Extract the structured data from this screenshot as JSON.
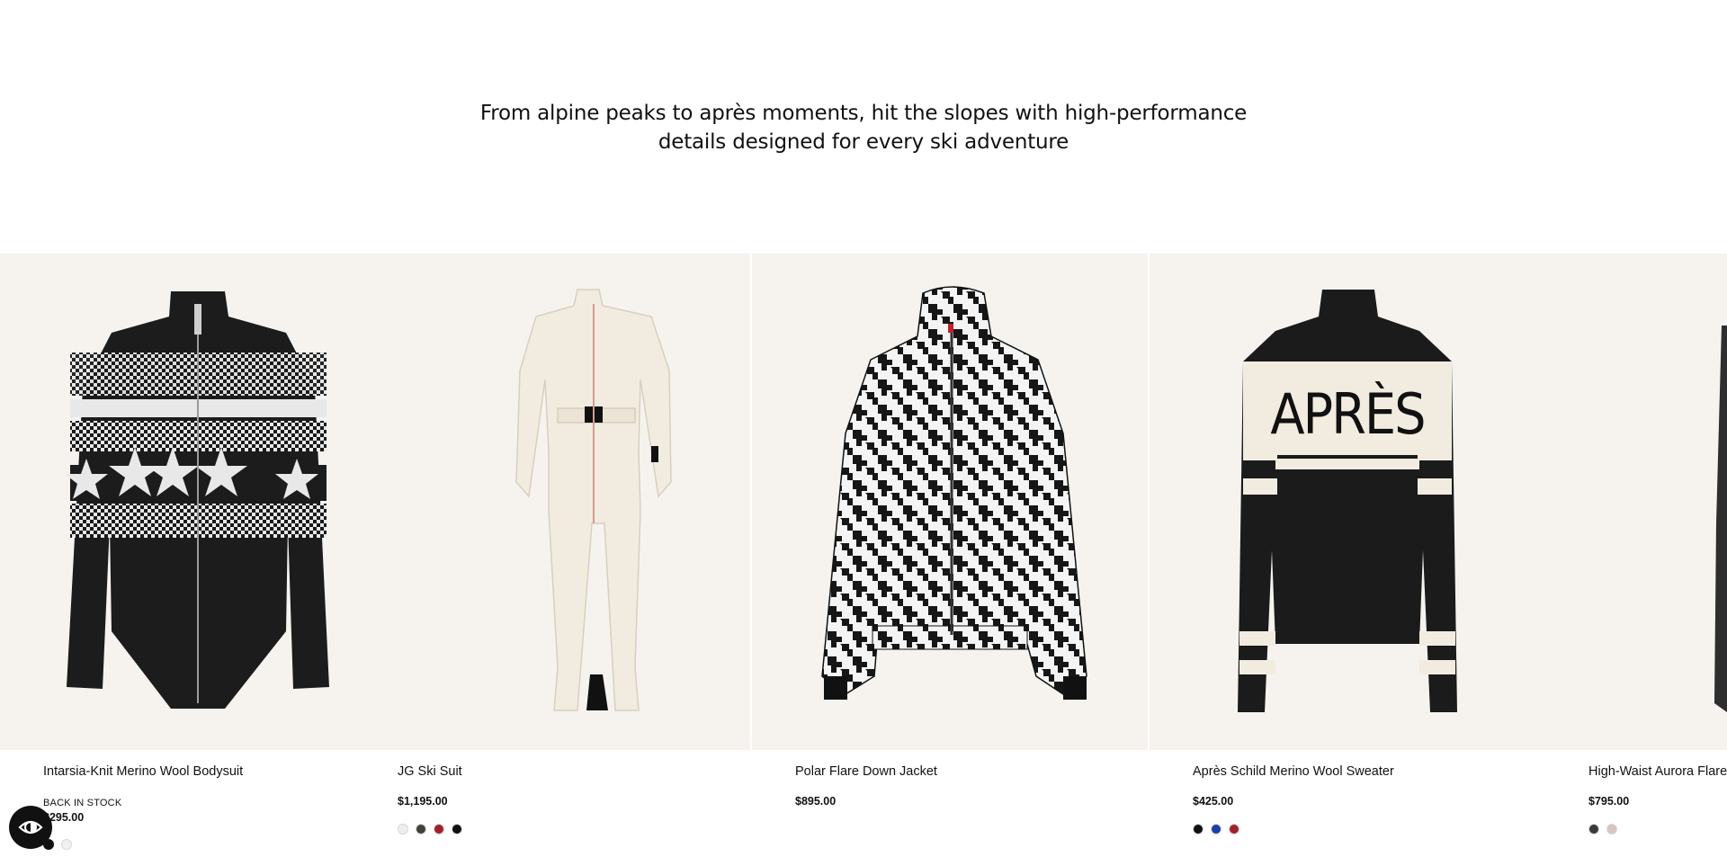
{
  "hero": {
    "line1": "From alpine peaks to après moments, hit the slopes with high-performance",
    "line2": "details designed for every ski adventure"
  },
  "products": [
    {
      "name": "Intarsia-Knit Merino Wool Bodysuit",
      "badge": "BACK IN STOCK",
      "price": "$295.00",
      "image_icon": "bodysuit-image",
      "swatches": [
        "#111111",
        "#f2f2f2"
      ]
    },
    {
      "name": "JG Ski Suit",
      "price": "$1,195.00",
      "image_icon": "ski-suit-image",
      "swatches": [
        "#eeeeee",
        "#3d4436",
        "#a3202a",
        "#111111"
      ]
    },
    {
      "name": "Polar Flare Down Jacket",
      "price": "$895.00",
      "image_icon": "down-jacket-image",
      "swatches": []
    },
    {
      "name": "Après Schild Merino Wool Sweater",
      "price": "$425.00",
      "image_icon": "sweater-image",
      "swatches": [
        "#111111",
        "#1c3fa8",
        "#a3202a"
      ]
    },
    {
      "name": "High-Waist Aurora Flare",
      "price": "$795.00",
      "image_icon": "flare-pants-image",
      "swatches": [
        "#3a3a3a",
        "#d9c4c4"
      ]
    }
  ],
  "accessibility": {
    "icon": "accessibility-icon"
  },
  "colors": {
    "image_bg": "#f6f3ef",
    "text": "#111111"
  }
}
